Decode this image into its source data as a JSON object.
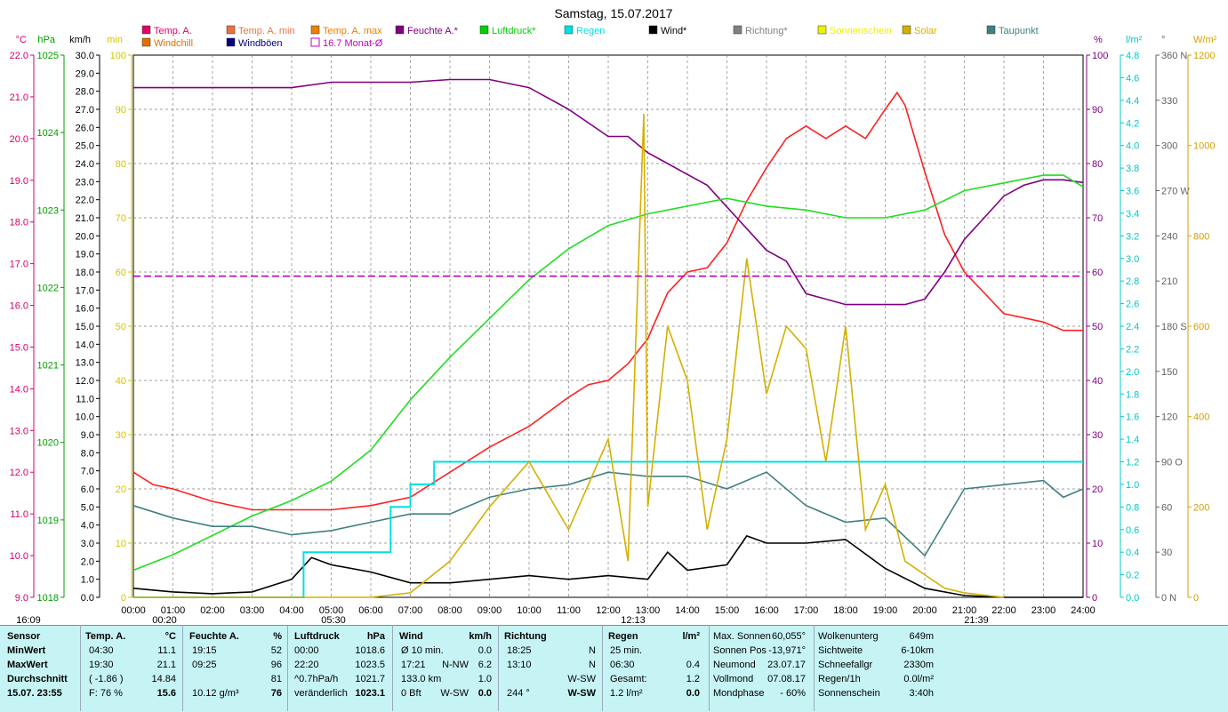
{
  "chart_data": {
    "type": "line",
    "title": "Samstag, 15.07.2017",
    "x_ticks": [
      "00:00",
      "01:00",
      "02:00",
      "03:00",
      "04:00",
      "05:00",
      "06:00",
      "07:00",
      "08:00",
      "09:00",
      "10:00",
      "11:00",
      "12:00",
      "13:00",
      "14:00",
      "15:00",
      "16:00",
      "17:00",
      "18:00",
      "19:00",
      "20:00",
      "21:00",
      "22:00",
      "23:00",
      "24:00"
    ],
    "below_axis_markers": [
      "16:09",
      "00:20",
      "05:30",
      "12:13",
      "21:39"
    ],
    "left_axes": [
      {
        "unit": "°C",
        "color": "#d4006f",
        "range": [
          9.0,
          22.0
        ],
        "ticks": [
          "22.0",
          "21.0",
          "20.0",
          "19.0",
          "18.0",
          "17.0",
          "16.0",
          "15.0",
          "14.0",
          "13.0",
          "12.0",
          "11.0",
          "10.0",
          "9.0"
        ]
      },
      {
        "unit": "hPa",
        "color": "#00a000",
        "range": [
          1018,
          1025
        ],
        "ticks": [
          "1025",
          "1024",
          "1023",
          "1022",
          "1021",
          "1020",
          "1019",
          "1018"
        ]
      },
      {
        "unit": "km/h",
        "color": "#000000",
        "range": [
          0,
          30
        ],
        "ticks": [
          "30.0",
          "29.0",
          "28.0",
          "27.0",
          "26.0",
          "25.0",
          "24.0",
          "23.0",
          "22.0",
          "21.0",
          "20.0",
          "19.0",
          "18.0",
          "17.0",
          "16.0",
          "15.0",
          "14.0",
          "13.0",
          "12.0",
          "11.0",
          "10.0",
          "9.0",
          "8.0",
          "7.0",
          "6.0",
          "5.0",
          "4.0",
          "3.0",
          "2.0",
          "1.0",
          "0.0"
        ]
      },
      {
        "unit": "min",
        "color": "#d4c400",
        "range": [
          0,
          100
        ],
        "ticks": [
          "100",
          "90",
          "80",
          "70",
          "60",
          "50",
          "40",
          "30",
          "20",
          "10",
          "0"
        ]
      }
    ],
    "right_axes": [
      {
        "unit": "%",
        "color": "#800080",
        "range": [
          0,
          100
        ],
        "ticks": [
          "100",
          "90",
          "80",
          "70",
          "60",
          "50",
          "40",
          "30",
          "20",
          "10",
          "0"
        ]
      },
      {
        "unit": "l/m²",
        "color": "#00c8c8",
        "range": [
          0,
          4.8
        ],
        "ticks": [
          "4.8",
          "4.6",
          "4.4",
          "4.2",
          "4.0",
          "3.8",
          "3.6",
          "3.4",
          "3.2",
          "3.0",
          "2.8",
          "2.6",
          "2.4",
          "2.2",
          "2.0",
          "1.8",
          "1.6",
          "1.4",
          "1.2",
          "1.0",
          "0.8",
          "0.6",
          "0.4",
          "0.2",
          "0.0"
        ]
      },
      {
        "unit": "°",
        "color": "#606060",
        "range": [
          0,
          360
        ],
        "ticks": [
          "360 N",
          "330",
          "300",
          "270 W",
          "240",
          "210",
          "180 S",
          "150",
          "120",
          "90  O",
          "60",
          "30",
          "0  N"
        ]
      },
      {
        "unit": "W/m²",
        "color": "#d4a000",
        "range": [
          0,
          1200
        ],
        "ticks": [
          "1200",
          "1000",
          "800",
          "600",
          "400",
          "200",
          "0"
        ]
      }
    ],
    "legend": [
      {
        "label": "Temp. A.",
        "color": "#e0006a",
        "shape": "box"
      },
      {
        "label": "Windchill",
        "color": "#e07000",
        "shape": "box"
      },
      {
        "label": "Temp. A. min",
        "color": "#f07040",
        "shape": "box"
      },
      {
        "label": "Windböen",
        "color": "#000080",
        "shape": "box"
      },
      {
        "label": "Temp. A. max",
        "color": "#f08000",
        "shape": "box"
      },
      {
        "label": "16.7 Monat-Ø",
        "color": "#c000c0",
        "shape": "open"
      },
      {
        "label": "Feuchte A.*",
        "color": "#800080",
        "shape": "box"
      },
      {
        "label": "Luftdruck*",
        "color": "#00d000",
        "shape": "box"
      },
      {
        "label": "Regen",
        "color": "#00e0e0",
        "shape": "box"
      },
      {
        "label": "Wind*",
        "color": "#000000",
        "shape": "box"
      },
      {
        "label": "Richtung*",
        "color": "#808080",
        "shape": "box"
      },
      {
        "label": "Sonnenschein",
        "color": "#f0f000",
        "shape": "box"
      },
      {
        "label": "Solar",
        "color": "#d4b000",
        "shape": "box"
      },
      {
        "label": "Taupunkt",
        "color": "#408080",
        "shape": "box"
      }
    ],
    "series": [
      {
        "name": "Temp. A.",
        "color": "#ff2020",
        "axis": "°C",
        "x": [
          0,
          0.5,
          1,
          2,
          3,
          4,
          5,
          6,
          7,
          8,
          9,
          10,
          11,
          11.5,
          12,
          12.5,
          13,
          13.5,
          14,
          14.5,
          15,
          15.5,
          16,
          16.5,
          17,
          17.5,
          18,
          18.5,
          19,
          19.3,
          19.5,
          20,
          20.5,
          21,
          21.5,
          22,
          23,
          23.5,
          24
        ],
        "y": [
          12.0,
          11.7,
          11.6,
          11.3,
          11.1,
          11.1,
          11.1,
          11.2,
          11.4,
          12.0,
          12.6,
          13.1,
          13.8,
          14.1,
          14.2,
          14.6,
          15.2,
          16.3,
          16.8,
          16.9,
          17.5,
          18.5,
          19.3,
          20.0,
          20.3,
          20.0,
          20.3,
          20.0,
          20.7,
          21.1,
          20.8,
          19.2,
          17.7,
          16.8,
          16.3,
          15.8,
          15.6,
          15.4,
          15.4
        ]
      },
      {
        "name": "Feuchte A.*",
        "color": "#800080",
        "axis": "%",
        "x": [
          0,
          2,
          4,
          5,
          6,
          7,
          8,
          9,
          10,
          11,
          12,
          12.5,
          13,
          13.5,
          14,
          14.5,
          15,
          15.5,
          16,
          16.5,
          17,
          17.5,
          18,
          18.5,
          19,
          19.5,
          20,
          20.5,
          21,
          21.5,
          22,
          22.5,
          23,
          23.5,
          24
        ],
        "y": [
          94,
          94,
          94,
          95,
          95,
          95,
          95.5,
          95.5,
          94,
          90,
          85,
          85,
          82,
          80,
          78,
          76,
          72,
          68,
          64,
          62,
          56,
          55,
          54,
          54,
          54,
          54,
          55,
          60,
          66,
          70,
          74,
          76,
          77,
          77,
          76.5
        ]
      },
      {
        "name": "Luftdruck*",
        "color": "#20dd20",
        "axis": "hPa",
        "x": [
          0,
          1,
          2,
          3,
          4,
          5,
          6,
          7,
          8,
          9,
          10,
          11,
          12,
          13,
          14,
          15,
          16,
          17,
          18,
          19,
          20,
          21,
          22,
          23,
          23.5,
          24
        ],
        "y": [
          1018.35,
          1018.55,
          1018.8,
          1019.05,
          1019.25,
          1019.5,
          1019.9,
          1020.55,
          1021.1,
          1021.6,
          1022.1,
          1022.5,
          1022.8,
          1022.95,
          1023.05,
          1023.15,
          1023.05,
          1023.0,
          1022.9,
          1022.9,
          1023.0,
          1023.25,
          1023.35,
          1023.45,
          1023.45,
          1023.3
        ]
      },
      {
        "name": "Taupunkt",
        "color": "#408080",
        "axis": "°C",
        "x": [
          0,
          1,
          2,
          3,
          4,
          5,
          6,
          7,
          8,
          9,
          10,
          11,
          12,
          13,
          14,
          15,
          16,
          17,
          18,
          19,
          20,
          21,
          22,
          23,
          23.5,
          24
        ],
        "y": [
          11.2,
          10.9,
          10.7,
          10.7,
          10.5,
          10.6,
          10.8,
          11.0,
          11.0,
          11.4,
          11.6,
          11.7,
          12.0,
          11.9,
          11.9,
          11.6,
          12.0,
          11.2,
          10.8,
          10.9,
          10.0,
          11.6,
          11.7,
          11.8,
          11.4,
          11.6
        ]
      },
      {
        "name": "Wind*",
        "color": "#000000",
        "axis": "km/h",
        "x": [
          0,
          1,
          2,
          3,
          4,
          4.5,
          5,
          6,
          7,
          8,
          9,
          10,
          11,
          12,
          13,
          13.5,
          14,
          15,
          15.5,
          16,
          17,
          18,
          19,
          20,
          21,
          22,
          23,
          24
        ],
        "y": [
          0.5,
          0.3,
          0.2,
          0.3,
          1.0,
          2.2,
          1.8,
          1.4,
          0.8,
          0.8,
          1.0,
          1.2,
          1.0,
          1.2,
          1.0,
          2.5,
          1.5,
          1.8,
          3.4,
          3.0,
          3.0,
          3.2,
          1.6,
          0.5,
          0.1,
          0,
          0,
          0
        ]
      },
      {
        "name": "Regen",
        "color": "#00e0e0",
        "axis": "l/m²",
        "x": [
          0,
          4,
          4.3,
          4.3,
          6.5,
          6.5,
          7.0,
          7.0,
          7.6,
          7.6,
          24
        ],
        "y": [
          0,
          0,
          0,
          0.4,
          0.4,
          0.8,
          0.8,
          1.0,
          1.0,
          1.2,
          1.2
        ]
      },
      {
        "name": "Solar",
        "color": "#d4b000",
        "axis": "W/m²",
        "x": [
          0,
          6,
          7,
          8,
          9,
          10,
          11,
          11.5,
          12,
          12.5,
          12.9,
          13,
          13.5,
          14,
          14.5,
          15,
          15.5,
          16,
          16.5,
          17,
          17.5,
          18,
          18.5,
          19,
          19.5,
          20,
          20.5,
          21,
          21.5,
          22
        ],
        "y": [
          0,
          0,
          10,
          80,
          200,
          300,
          150,
          250,
          350,
          80,
          1070,
          200,
          600,
          480,
          150,
          350,
          750,
          450,
          600,
          550,
          300,
          600,
          150,
          250,
          80,
          50,
          20,
          10,
          5,
          0
        ]
      },
      {
        "name": "16.7 Monat-Ø",
        "color": "#c000c0",
        "axis": "°C",
        "x": [
          0,
          24
        ],
        "y": [
          16.7,
          16.7
        ]
      }
    ],
    "stats": {
      "headers": [
        "Sensor",
        "Temp. A.",
        "°C",
        "Feuchte A.",
        "%",
        "Luftdruck",
        "hPa",
        "Wind",
        "km/h",
        "Richtung",
        "Regen",
        "l/m²"
      ],
      "row_labels": [
        "MinWert",
        "MaxWert",
        "Durchschnitt",
        "15.07. 23:55"
      ],
      "temp": [
        [
          "04:30",
          "11.1"
        ],
        [
          "19:30",
          "21.1"
        ],
        [
          "( -1.86 )",
          "14.84"
        ],
        [
          "F: 76 %",
          "15.6"
        ]
      ],
      "feuchte": [
        [
          "19:15",
          "52"
        ],
        [
          "09:25",
          "96"
        ],
        [
          "",
          "81"
        ],
        [
          "10.12 g/m³",
          "76"
        ]
      ],
      "luftdruck": [
        [
          "00:00",
          "1018.6"
        ],
        [
          "22:20",
          "1023.5"
        ],
        [
          "^0.7hPa/h",
          "1021.7"
        ],
        [
          "veränderlich",
          "1023.1"
        ]
      ],
      "wind": [
        [
          "Ø 10 min.",
          "",
          "0.0"
        ],
        [
          "17:21",
          "N-NW",
          "6.2"
        ],
        [
          "133.0 km",
          "",
          "1.0"
        ],
        [
          "0 Bft",
          "W-SW",
          "0.0"
        ]
      ],
      "richtung": [
        [
          "18:25",
          "N"
        ],
        [
          "13:10",
          "N"
        ],
        [
          "",
          "W-SW"
        ],
        [
          "244 °",
          "W-SW"
        ]
      ],
      "regen": [
        [
          "25 min.",
          ""
        ],
        [
          "06:30",
          "0.4"
        ],
        [
          "Gesamt:",
          "1.2"
        ],
        [
          "1.2 l/m²",
          "0.0"
        ]
      ],
      "astro": [
        [
          "Max. Sonnen",
          "60,055°"
        ],
        [
          "Sonnen Pos",
          "-13,971°"
        ],
        [
          "Neumond",
          "23.07.17"
        ],
        [
          "Vollmond",
          "07.08.17"
        ],
        [
          "Mondphase",
          "- 60%"
        ]
      ],
      "weather": [
        [
          "Wolkenunterg",
          "649m"
        ],
        [
          "Sichtweite",
          "6-10km"
        ],
        [
          "Schneefallgr",
          "2330m"
        ],
        [
          "Regen/1h",
          "0.0l/m²"
        ],
        [
          "Sonnenschein",
          "3:40h"
        ]
      ]
    }
  }
}
